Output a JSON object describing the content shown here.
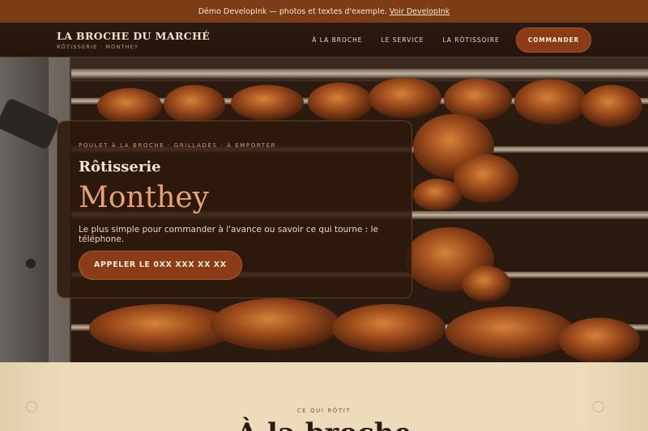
{
  "banner": {
    "text": "Démo DevelopInk — photos et textes d'exemple.",
    "link": "Voir DevelopInk"
  },
  "brand": {
    "title": "LA BROCHE DU MARCHÉ",
    "subtitle": "RÔTISSERIE · MONTHEY"
  },
  "nav": {
    "links": [
      "À LA BROCHE",
      "LE SERVICE",
      "LA RÔTISSOIRE"
    ],
    "cta": "COMMANDER"
  },
  "hero": {
    "kicker": "POULET À LA BROCHE · GRILLADES · À EMPORTER",
    "subtitle": "Rôtisserie",
    "title": "Monthey",
    "description": "Le plus simple pour commander à l'avance ou savoir ce qui tourne : le téléphone.",
    "cta": "APPELER LE 0XX XXX XX XX"
  },
  "section": {
    "eyebrow": "CE QUI RÔTIT",
    "heading": "À la broche"
  },
  "colors": {
    "accent": "#8b3c16",
    "banner": "#7c3d14",
    "nav": "#2b1a10",
    "cream": "#ecdcbc",
    "title": "#e9a171"
  }
}
